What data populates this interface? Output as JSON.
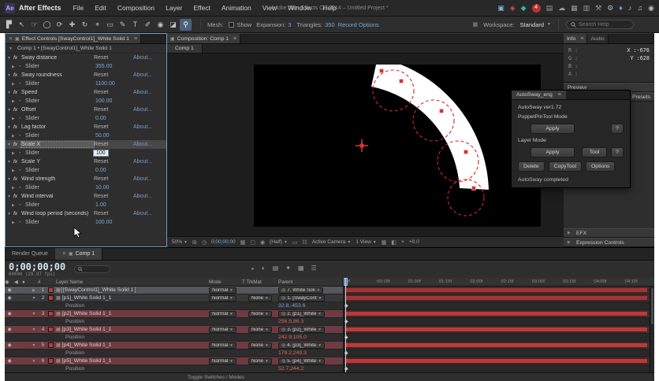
{
  "colors": {
    "accent_blue": "#7ba7d7",
    "bar_red": "#a23434",
    "bar_red_highlight": "#b83a3a",
    "selection_red_row": "#6e3b40",
    "focus_border": "#6f9bbf",
    "position_red": "#e0685a"
  },
  "glyphs": {
    "close": "✕",
    "panel_menu": "≡",
    "panel_icon": "▣",
    "caret_down": "▼",
    "twirl_open": "▼",
    "twirl_closed": "▶",
    "eye": "◉",
    "fx_badge": "fx",
    "stopwatch": "◔",
    "pickwhip": "◎",
    "solid_layer": "▦",
    "speaker": "◀",
    "dot": "●",
    "hash": "#",
    "keyframe": "◆",
    "grid": "⊞",
    "clock": "◷",
    "film": "▦",
    "box": "▢",
    "camera": "◉",
    "mask": "▭",
    "wire": "☷",
    "half": "◧",
    "target": "⌖",
    "workspace": "▦",
    "bullet": "•"
  },
  "menubar": {
    "app_badge": "Ae",
    "app_name": "After Effects",
    "menus": [
      "File",
      "Edit",
      "Composition",
      "Layer",
      "Effect",
      "Animation",
      "View",
      "Window",
      "Help"
    ],
    "window_title": "Adobe After Effects CC 2014 – Untitled Project *",
    "status_icons": [
      {
        "name": "monitor-icon",
        "glyph": "▣",
        "color": "#7fb2dc"
      },
      {
        "name": "stock-icon",
        "glyph": "◈",
        "color": "#cc5555"
      },
      {
        "name": "sync-settings-icon",
        "glyph": "◆",
        "color": "#3fae9e"
      },
      {
        "name": "notification-badge",
        "glyph": "4",
        "color": "#ffffff",
        "bg": "#c03030"
      },
      {
        "name": "folder-icon",
        "glyph": "▤",
        "color": "#999999"
      },
      {
        "name": "cloud-icon",
        "glyph": "☁",
        "color": "#999999"
      },
      {
        "name": "grid-icon",
        "glyph": "▦",
        "color": "#999999"
      },
      {
        "name": "panels-icon",
        "glyph": "▥",
        "color": "#999999"
      },
      {
        "name": "tools-icon",
        "glyph": "⚒",
        "color": "#999999"
      },
      {
        "name": "gear-icon",
        "glyph": "⚙",
        "color": "#bbbbbb"
      },
      {
        "name": "gem-icon",
        "glyph": "♦",
        "color": "#6fa0d0"
      },
      {
        "name": "audio-icon",
        "glyph": "♪",
        "color": "#bbbbbb"
      },
      {
        "name": "media-icon",
        "glyph": "♫",
        "color": "#bbbbbb"
      },
      {
        "name": "power-icon",
        "glyph": "◉",
        "color": "#bbbbbb"
      }
    ]
  },
  "toolbar": {
    "tools": [
      {
        "name": "panel-toggle-icon",
        "glyph": "▛"
      },
      {
        "name": "selection-tool",
        "glyph": "↖"
      },
      {
        "name": "hand-tool",
        "glyph": "☞"
      },
      {
        "name": "zoom-tool",
        "glyph": "◯"
      },
      {
        "name": "orbit-tool",
        "glyph": "⟳"
      },
      {
        "name": "pan-tool",
        "glyph": "✚"
      },
      {
        "name": "rotation-tool",
        "glyph": "↻"
      },
      {
        "name": "pan-behind-tool",
        "glyph": "⌖"
      },
      {
        "name": "mask-tool",
        "glyph": "▭"
      },
      {
        "name": "pen-tool",
        "glyph": "✎"
      },
      {
        "name": "type-tool",
        "glyph": "T"
      },
      {
        "name": "brush-tool",
        "glyph": "✐"
      },
      {
        "name": "clone-stamp-tool",
        "glyph": "◉"
      },
      {
        "name": "eraser-tool",
        "glyph": "◪"
      },
      {
        "name": "puppet-pin-tool",
        "glyph": "⚲",
        "active": true
      }
    ],
    "mesh_label": "Mesh:",
    "show_label": "Show",
    "expansion_label": "Expansion:",
    "expansion_value": "3",
    "triangles_label": "Triangles:",
    "triangles_value": "350",
    "record_options_label": "Record Options",
    "workspace_label": "Workspace:",
    "workspace_value": "Standard",
    "search_placeholder": "Search Help"
  },
  "effect_controls": {
    "tab_title": "Effect Controls [SwayControl1]_White Solid 1",
    "breadcrumb": "Comp 1 • [SwayControl1]_White Solid 1",
    "reset_label": "Reset",
    "about_label": "About...",
    "slider_label": "Slider",
    "effects": [
      {
        "name": "Sway distance",
        "value": "355.00"
      },
      {
        "name": "Sway roundness",
        "value": "1100.00"
      },
      {
        "name": "Speed",
        "value": "100.00"
      },
      {
        "name": "Offset",
        "value": "0.00"
      },
      {
        "name": "Lag factor",
        "value": "50.00"
      },
      {
        "name": "Scale X",
        "value": "100",
        "selected": true,
        "editing": true
      },
      {
        "name": "Scale Y",
        "value": "0.00"
      },
      {
        "name": "Wind strength",
        "value": "10.00"
      },
      {
        "name": "Wind interval",
        "value": "1.00"
      },
      {
        "name": "Wind loop period (seconds)",
        "value": "100.00"
      }
    ]
  },
  "composition": {
    "tab_title": "Composition: Comp 1",
    "comp_tab_label": "Comp 1",
    "statusbar": {
      "zoom": "50%",
      "timecode": "0;00;00;00",
      "resolution": "(Half)",
      "camera": "Active Camera",
      "view_layout": "1 View",
      "exposure": "+0.0"
    }
  },
  "info_panel": {
    "tab_info": "Info",
    "tab_audio": "Audio",
    "channels": [
      "R :",
      "G :",
      "B :",
      "A :"
    ],
    "x_label": "X :",
    "x_value": "-676",
    "y_label": "Y :",
    "y_value": "628"
  },
  "right_panels": {
    "preview_label": "Preview",
    "presets_label": "Presets",
    "efx_label": "EFX",
    "expression_controls_label": "Expression Controls"
  },
  "autosway": {
    "panel_title": "AutoSway_eng",
    "version": "AutoSway ver1.72",
    "puppet_section_label": "PuppetPinTool Mode",
    "layer_section_label": "Layer Mode",
    "apply_label": "Apply",
    "help_label": "?",
    "tool_label": "Tool",
    "delete_label": "Delete",
    "copytool_label": "CopyTool",
    "options_label": "Options",
    "status_text": "AutoSway completed"
  },
  "timeline": {
    "tab_render_queue": "Render Queue",
    "tab_comp": "Comp 1",
    "timecode": "0;00;00;00",
    "frame_info": "00000 (29.97 fps)",
    "columns": {
      "layer_name": "Layer Name",
      "mode": "Mode",
      "trkmat": "T TrkMat",
      "parent": "Parent"
    },
    "position_label": "Position",
    "header_icons": [
      {
        "name": "comp-mini-flowchart-icon",
        "glyph": "◒"
      },
      {
        "name": "draft-3d-icon",
        "glyph": "◐"
      },
      {
        "name": "hide-shy-icon",
        "glyph": "▤"
      },
      {
        "name": "frame-blending-icon",
        "glyph": "✦"
      },
      {
        "name": "motion-blur-icon",
        "glyph": "▦"
      },
      {
        "name": "graph-editor-icon",
        "glyph": "☰"
      }
    ],
    "rows": [
      {
        "num": "1",
        "name": "[SwayControl1]_White Solid 1",
        "mode": "Normal",
        "trkmat": "",
        "parent": "7. White Soli",
        "selected": true
      },
      {
        "num": "2",
        "name": "[p1]_White Solid 1_1",
        "mode": "Normal",
        "trkmat": "None",
        "parent": "1. [SwayCont",
        "position": "32.8,-453.6",
        "pos_style": "blue"
      },
      {
        "num": "3",
        "name": "[p2]_White Solid 1_1",
        "mode": "Normal",
        "trkmat": "None",
        "parent": "2. [p1]_White",
        "position": "256.5,86.3",
        "pos_style": "red",
        "highlight": true
      },
      {
        "num": "4",
        "name": "[p3]_White Solid 1_1",
        "mode": "Normal",
        "trkmat": "None",
        "parent": "3. [p2]_White",
        "position": "242.9,105.0",
        "pos_style": "red",
        "highlight": true
      },
      {
        "num": "5",
        "name": "[p4]_White Solid 1_1",
        "mode": "Normal",
        "trkmat": "None",
        "parent": "4. [p3]_White",
        "position": "179.2,249.3",
        "pos_style": "red",
        "highlight": true
      },
      {
        "num": "6",
        "name": "[p5]_White Solid 1_1",
        "mode": "Normal",
        "trkmat": "None",
        "parent": "5. [p4]_White",
        "position": "52.7,244.2",
        "pos_style": "red",
        "highlight": true
      }
    ],
    "ruler_labels": [
      "0f",
      "00:15f",
      "01:00f",
      "01:15f",
      "02:00f",
      "02:15f",
      "03:00f",
      "03:15f",
      "04:00f",
      "04:15f"
    ],
    "bottom_label": "Toggle Switches / Modes"
  }
}
